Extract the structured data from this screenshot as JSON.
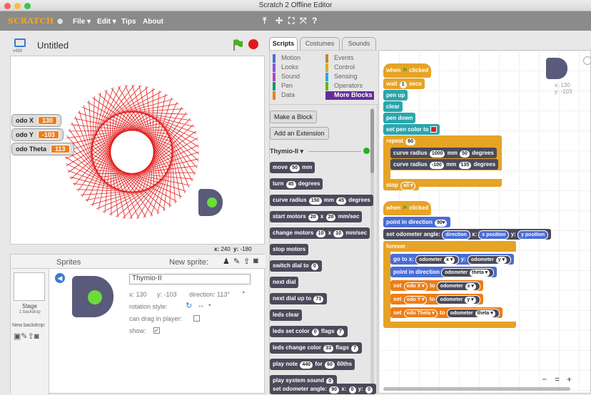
{
  "window": {
    "title": "Scratch 2 Offline Editor"
  },
  "menu": {
    "logo": "SCRATCH",
    "file": "File ▾",
    "edit": "Edit ▾",
    "tips": "Tips",
    "about": "About"
  },
  "stage": {
    "name": "Untitled",
    "version": "v430",
    "x_label": "x:",
    "x": "240",
    "y_label": "y:",
    "y": "-180"
  },
  "monitors": [
    {
      "label": "odo X",
      "value": "130"
    },
    {
      "label": "odo Y",
      "value": "-103"
    },
    {
      "label": "odo Theta",
      "value": "113"
    }
  ],
  "tabs": [
    "Scripts",
    "Costumes",
    "Sounds"
  ],
  "categories": [
    {
      "name": "Motion",
      "color": "#4a6cd4"
    },
    {
      "name": "Events",
      "color": "#c88330"
    },
    {
      "name": "Looks",
      "color": "#8a55d7"
    },
    {
      "name": "Control",
      "color": "#e1a91a"
    },
    {
      "name": "Sound",
      "color": "#bb42c3"
    },
    {
      "name": "Sensing",
      "color": "#2ca5e2"
    },
    {
      "name": "Pen",
      "color": "#0e9a6c"
    },
    {
      "name": "Operators",
      "color": "#5cb712"
    },
    {
      "name": "Data",
      "color": "#ee7d16"
    },
    {
      "name": "More Blocks",
      "color": "#632d99"
    }
  ],
  "palette": {
    "make_block": "Make a Block",
    "add_extension": "Add an Extension",
    "extension": "Thymio-II ▾",
    "blocks": [
      "move (50) mm",
      "turn (45) degrees",
      "curve radius (150) mm (45) degrees",
      "start motors (20) x (20) mm/sec",
      "change motors (10) x (10) mm/sec",
      "stop motors",
      "switch dial to (0)",
      "next dial",
      "next dial up to (71)",
      "leds clear",
      "leds set color (0) flags (7)",
      "leds change color (33) flags (7)",
      "play note (440) for (60) 60ths",
      "play system sound (0)",
      "set odometer angle: (90) x: (0) y: (0)"
    ]
  },
  "sprites": {
    "title": "Sprites",
    "new_sprite": "New sprite:",
    "stage_label": "Stage",
    "stage_sub": "1 backdrop",
    "new_backdrop": "New backdrop:",
    "name": "Thymio-II",
    "x": "x: 130",
    "y": "y: -103",
    "direction": "direction: 113°",
    "rotation": "rotation style:",
    "drag": "can drag in player:",
    "show": "show:"
  },
  "sprite_coords": {
    "x": "x: 130",
    "y": "y: -103"
  },
  "script1": {
    "hat": "when",
    "hat2": "clicked",
    "wait": "wait",
    "wait_v": "1",
    "wait_u": "secs",
    "penup": "pen up",
    "clear": "clear",
    "pendown": "pen down",
    "setcolor": "set pen color to",
    "repeat": "repeat",
    "repeat_v": "60",
    "curve1": "curve radius",
    "c1a": "1000",
    "c1b": "mm",
    "c1c": "50",
    "c1d": "degrees",
    "curve2": "curve radius",
    "c2a": "-100",
    "c2b": "mm",
    "c2c": "135",
    "c2d": "degrees",
    "stop": "stop",
    "stop_v": "all ▾"
  },
  "script2": {
    "hat": "when",
    "hat2": "clicked",
    "point": "point in direction",
    "point_v": "90▾",
    "setodo": "set odometer angle:",
    "dir": "direction",
    "x": "x:",
    "xpos": "x position",
    "y": "y:",
    "ypos": "y position",
    "forever": "forever",
    "goto": "go to x:",
    "odo": "odometer",
    "xsel": "x ▾",
    "ysel": "y ▾",
    "pointdir": "point in direction",
    "theta": "theta ▾",
    "set": "set",
    "to": "to",
    "v1": "odo X ▾",
    "v2": "odo Y ▾",
    "v3": "odo Theta ▾"
  },
  "zoom": {
    "minus": "−",
    "equal": "=",
    "plus": "+"
  }
}
